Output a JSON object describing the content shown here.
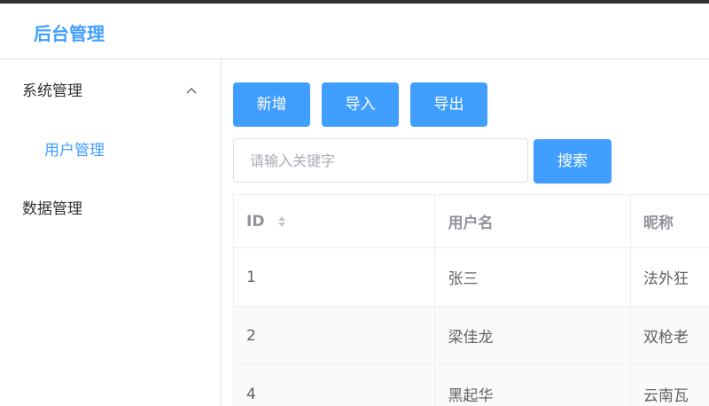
{
  "header": {
    "title": "后台管理"
  },
  "sidebar": {
    "items": [
      {
        "label": "系统管理",
        "expanded": true,
        "icon": "chevron-up-icon"
      },
      {
        "label": "用户管理",
        "active": true
      },
      {
        "label": "数据管理"
      }
    ]
  },
  "toolbar": {
    "add_label": "新增",
    "import_label": "导入",
    "export_label": "导出",
    "search_label": "搜索"
  },
  "search": {
    "placeholder": "请输入关键字",
    "value": ""
  },
  "table": {
    "columns": [
      {
        "label": "ID",
        "sortable": true,
        "icon": "sort-caret-icon"
      },
      {
        "label": "用户名"
      },
      {
        "label": "昵称"
      }
    ],
    "rows": [
      [
        "1",
        "张三",
        "法外狂"
      ],
      [
        "2",
        "梁佳龙",
        "双枪老"
      ],
      [
        "4",
        "黑起华",
        "云南瓦"
      ]
    ]
  },
  "colors": {
    "accent": "#409eff",
    "header_text": "#909399",
    "cell_text": "#606266",
    "border": "#ebeef5",
    "stripe": "#fafafa"
  }
}
